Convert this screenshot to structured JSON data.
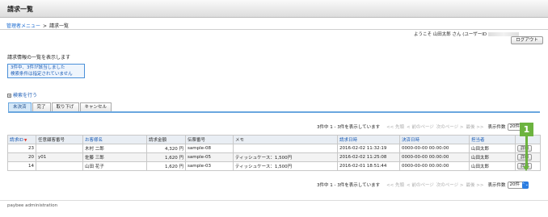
{
  "header": {
    "title": "請求一覧"
  },
  "breadcrumb": {
    "parent": "管理者メニュー",
    "separator": ">",
    "current": "請求一覧"
  },
  "user": {
    "welcome": "ようこそ 山田太郎 さん (ユーザーID"
  },
  "buttons": {
    "logout": "ログアウト",
    "detail": "詳細"
  },
  "page": {
    "description": "請求情報の一覧を表示します",
    "notice": [
      "3件中、3件が該当しました",
      "検索条件は指定されていません"
    ],
    "search_toggle": {
      "icon_symbol": "+",
      "label": "検索を行う"
    }
  },
  "tabs": [
    {
      "label": "未決済",
      "active": true
    },
    {
      "label": "完了",
      "active": false
    },
    {
      "label": "取り下げ",
      "active": false
    },
    {
      "label": "キャンセル",
      "active": false
    }
  ],
  "pager": {
    "info": "3件中 1 - 3件を表示しています",
    "first": "<< 先頭",
    "prev": "< 前のページ",
    "next": "次のページ >",
    "last": "最後 >>",
    "per_page_label": "表示件数",
    "per_page_value": "20件",
    "chevron": "⌃⌄"
  },
  "table": {
    "sort_arrow": "▼",
    "columns": [
      "請求ID",
      "任意顧客番号",
      "お客様名",
      "請求金額",
      "伝票番号",
      "メモ",
      "請求日時",
      "決済日時",
      "担当者",
      ""
    ],
    "rows": [
      {
        "id": "23",
        "customer_no": "",
        "name": "木村 二郎",
        "amount": "4,320 円",
        "slip": "sample-08",
        "memo": "",
        "billed_at": "2016-02-02 11:32:19",
        "paid_at": "0000-00-00 00:00:00",
        "staff": "山田太郎"
      },
      {
        "id": "20",
        "customer_no": "y01",
        "name": "佐藤 三郎",
        "amount": "1,620 円",
        "slip": "sample-05",
        "memo": "ティッシュケース：1,500円",
        "billed_at": "2016-02-02 11:25:08",
        "paid_at": "0000-00-00 00:00:00",
        "staff": "山田太郎"
      },
      {
        "id": "14",
        "customer_no": "",
        "name": "山田 花子",
        "amount": "1,620 円",
        "slip": "sample-03",
        "memo": "ティッシュケース：1,500円",
        "billed_at": "2016-02-01 18:51:44",
        "paid_at": "0000-00-00 00:00:00",
        "staff": "山田太郎"
      }
    ]
  },
  "callout": {
    "number": "1",
    "color": "#6cb33f"
  },
  "footer": {
    "text": "paybee administration"
  },
  "colors": {
    "link": "#1a5bb5",
    "tab_active": "#d5e8f8",
    "accent": "#6aa7df",
    "header_cell": "#e9eef4"
  }
}
